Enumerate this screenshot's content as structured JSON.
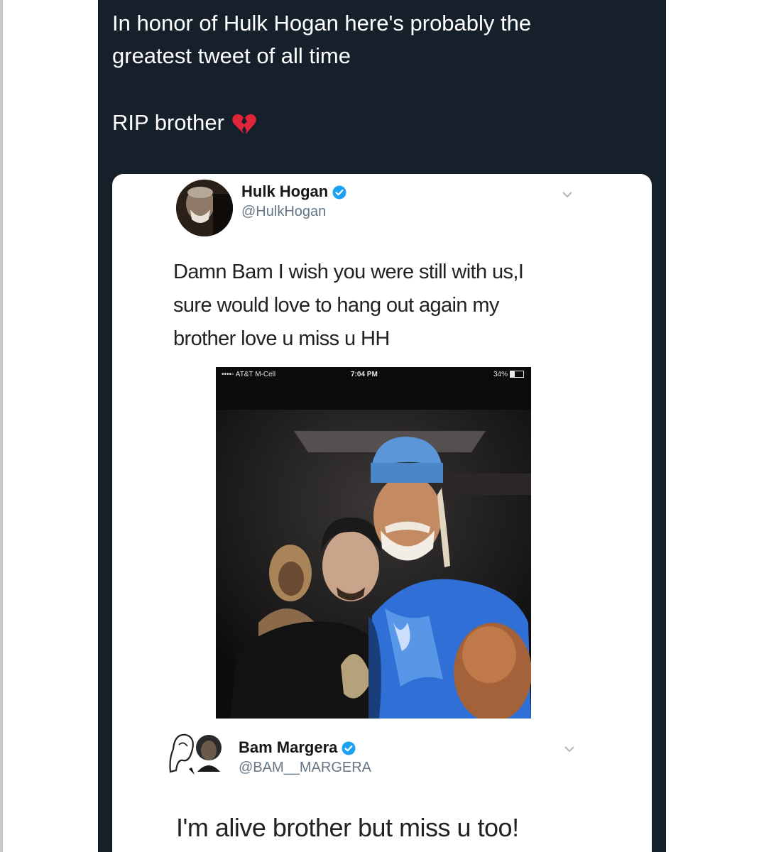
{
  "post": {
    "line1": "In honor of Hulk Hogan here's probably the",
    "line2": "greatest tweet of all time",
    "line3": "RIP brother",
    "emoji": "broken-heart-icon"
  },
  "embedded_tweet": {
    "author_name": "Hulk Hogan",
    "author_handle": "@HulkHogan",
    "verified_icon": "verified-badge-icon",
    "text_line1": "Damn  Bam I wish you were still with us,I",
    "text_line2": "sure would love to hang out again my",
    "text_line3": "brother love u miss u HH",
    "screenshot": {
      "carrier": "••••◦ AT&T M-Cell",
      "time": "7:04 PM",
      "battery": "34%",
      "battery_level": 0.34
    }
  },
  "reply_tweet": {
    "author_name": "Bam Margera",
    "author_handle": "@BAM__MARGERA",
    "verified_icon": "verified-badge-icon",
    "text": "I'm alive brother but miss u too!"
  },
  "colors": {
    "post_background": "#15202b",
    "post_text": "#ffffff",
    "verified_blue": "#1da1f2",
    "handle_gray": "#657786"
  }
}
